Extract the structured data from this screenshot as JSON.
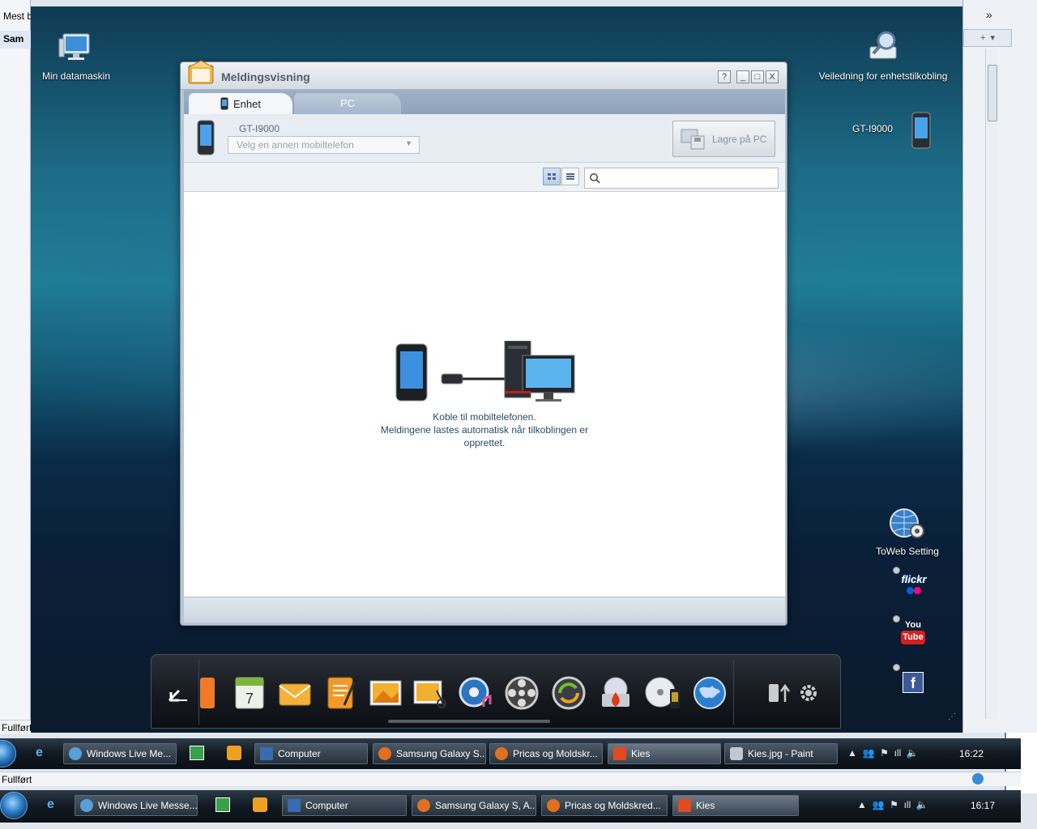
{
  "outer_browser": {
    "left_rows": [
      "Mest b",
      "Sam"
    ],
    "status_text": "Fullført",
    "nav_arrows": "»"
  },
  "desktop": {
    "icons": [
      {
        "label": "Min datamaskin"
      },
      {
        "label": "Veiledning for enhetstilkobling"
      },
      {
        "label": "GT-I9000"
      },
      {
        "label": "ToWeb Setting"
      }
    ],
    "social": [
      "flickr",
      "You Tube",
      "f"
    ]
  },
  "window": {
    "title": "Meldingsvisning",
    "help_label": "?",
    "min_label": "_",
    "max_label": "□",
    "close_label": "X",
    "tabs": [
      {
        "label": "Enhet"
      },
      {
        "label": "PC"
      }
    ],
    "device_name": "GT-I9000",
    "device_select_placeholder": "Velg en annen mobiltelefon",
    "save_button": "Lagre på PC",
    "message_lines": [
      "Koble til mobiltelefonen.",
      "Meldingene lastes automatisk når tilkoblingen er",
      "opprettet."
    ]
  },
  "taskbar_inner": {
    "buttons": [
      {
        "label": "Windows Live Me..."
      },
      {
        "label": "Computer"
      },
      {
        "label": "Samsung Galaxy S..."
      },
      {
        "label": "Pricas og Moldskr..."
      },
      {
        "label": "Kies"
      },
      {
        "label": "Kies.jpg - Paint"
      }
    ],
    "clock": "16:22",
    "status_text": "Fullført"
  },
  "taskbar_outer": {
    "buttons": [
      {
        "label": "Windows Live Messe..."
      },
      {
        "label": "Computer"
      },
      {
        "label": "Samsung Galaxy S, A..."
      },
      {
        "label": "Pricas og Moldskred..."
      },
      {
        "label": "Kies"
      }
    ],
    "clock": "16:17"
  },
  "colors": {
    "accent": "#2b7cc4",
    "window_bg": "#b9c5d2",
    "message_text": "#2a4a6a"
  }
}
